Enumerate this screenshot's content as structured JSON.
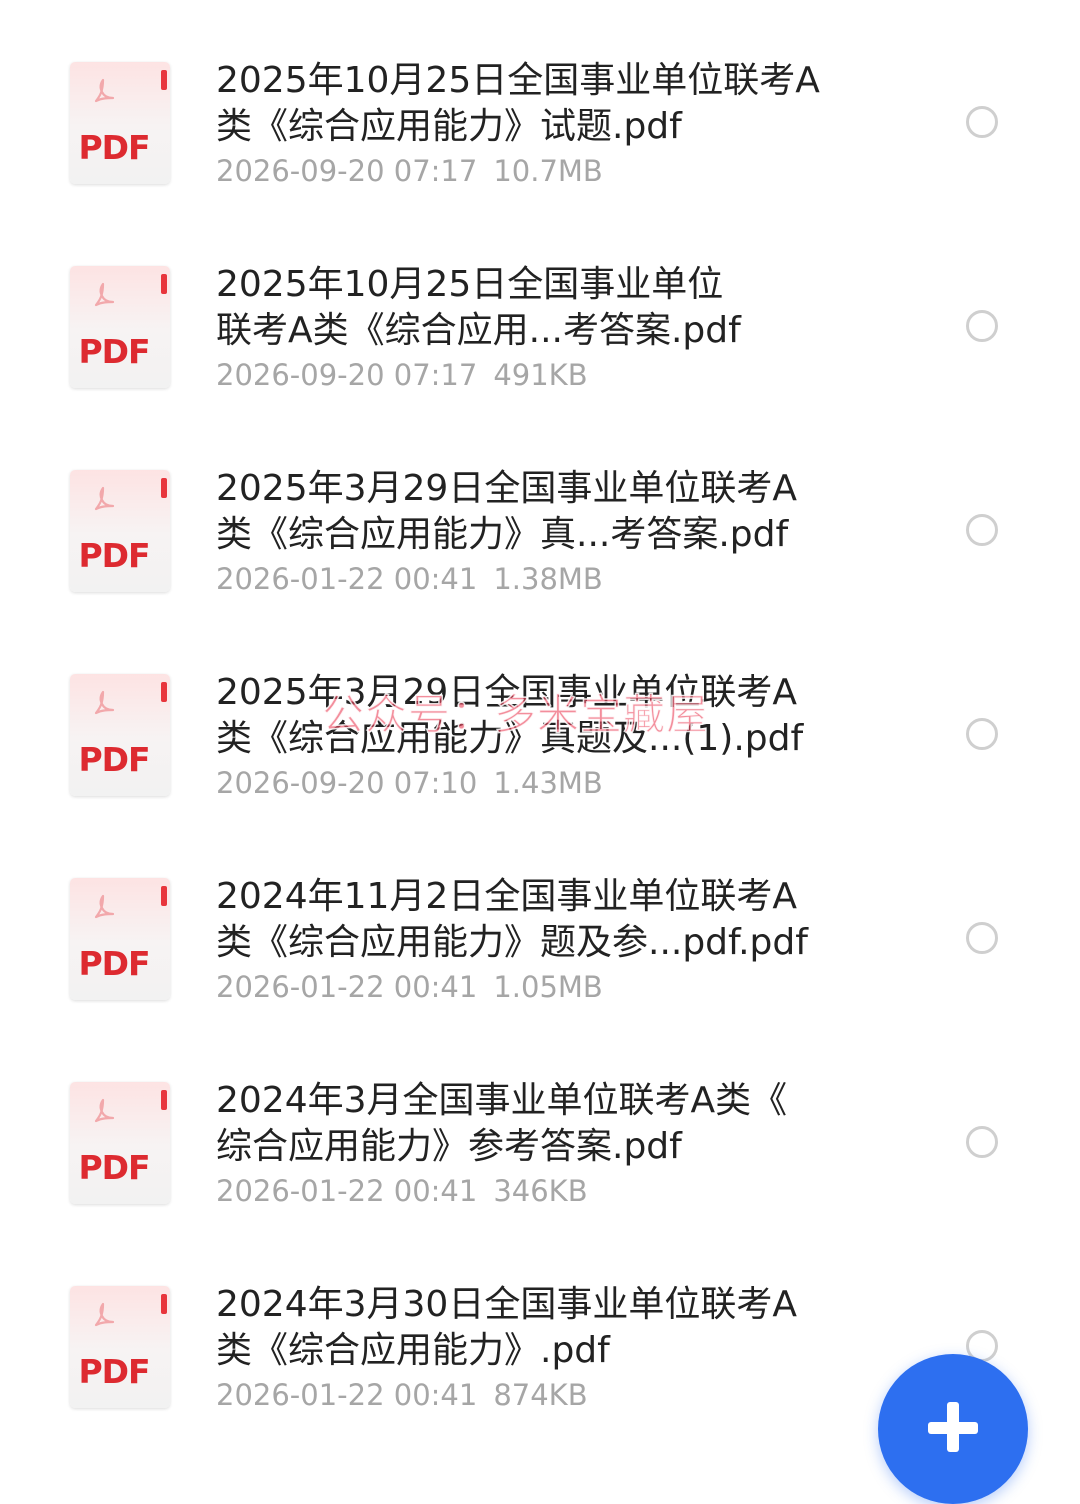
{
  "files": [
    {
      "icon_label": "PDF",
      "name": "2025年10月25日全国事业单位联考A\n类《综合应用能力》试题.pdf",
      "date": "2026-09-20 07:17",
      "size": "10.7MB",
      "selected": false
    },
    {
      "icon_label": "PDF",
      "name": "2025年10月25日全国事业单位\n联考A类《综合应用...考答案.pdf",
      "date": "2026-09-20 07:17",
      "size": "491KB",
      "selected": false
    },
    {
      "icon_label": "PDF",
      "name": "2025年3月29日全国事业单位联考A\n类《综合应用能力》真...考答案.pdf",
      "date": "2026-01-22 00:41",
      "size": "1.38MB",
      "selected": false
    },
    {
      "icon_label": "PDF",
      "name": "2025年3月29日全国事业单位联考A\n类《综合应用能力》真题及...(1).pdf",
      "date": "2026-09-20 07:10",
      "size": "1.43MB",
      "selected": false
    },
    {
      "icon_label": "PDF",
      "name": "2024年11月2日全国事业单位联考A\n类《综合应用能力》题及参...pdf.pdf",
      "date": "2026-01-22 00:41",
      "size": "1.05MB",
      "selected": false
    },
    {
      "icon_label": "PDF",
      "name": "2024年3月全国事业单位联考A类《\n综合应用能力》参考答案.pdf",
      "date": "2026-01-22 00:41",
      "size": "346KB",
      "selected": false
    },
    {
      "icon_label": "PDF",
      "name": "2024年3月30日全国事业单位联考A\n类《综合应用能力》.pdf",
      "date": "2026-01-22 00:41",
      "size": "874KB",
      "selected": false
    }
  ],
  "watermark": "公众号：多米宝藏屋",
  "fab": {
    "icon": "plus-icon"
  },
  "colors": {
    "pdf_red": "#dd2a30",
    "fab_blue": "#2d6ff0",
    "meta_gray": "#a6a6a6"
  }
}
